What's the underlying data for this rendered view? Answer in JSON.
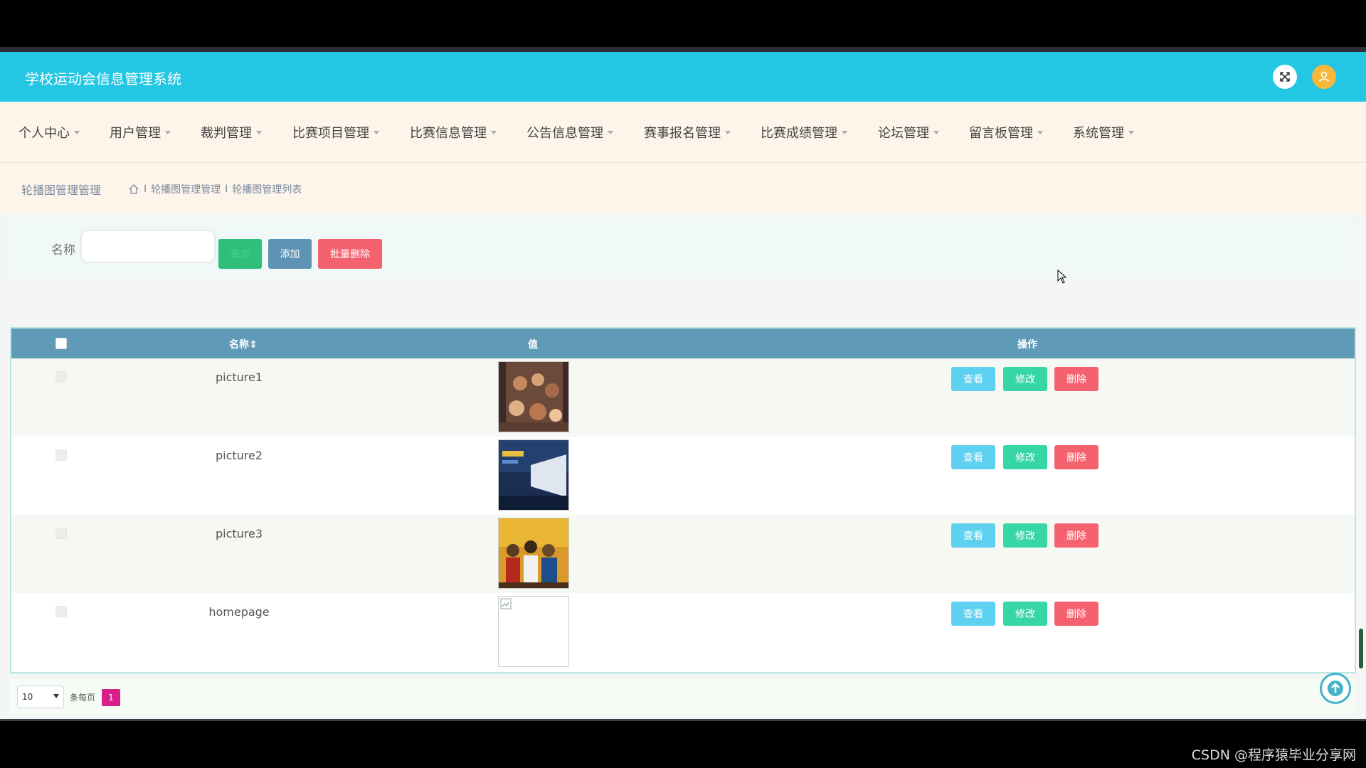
{
  "app": {
    "title": "学校运动会信息管理系统"
  },
  "header": {
    "expand_icon": "fullscreen-icon",
    "user_icon": "user-avatar-icon"
  },
  "nav": {
    "items": [
      {
        "label": "个人中心"
      },
      {
        "label": "用户管理"
      },
      {
        "label": "裁判管理"
      },
      {
        "label": "比赛项目管理"
      },
      {
        "label": "比赛信息管理"
      },
      {
        "label": "公告信息管理"
      },
      {
        "label": "赛事报名管理"
      },
      {
        "label": "比赛成绩管理"
      },
      {
        "label": "论坛管理"
      },
      {
        "label": "留言板管理"
      },
      {
        "label": "系统管理"
      }
    ]
  },
  "breadcrumb": {
    "page_title": "轮播图管理管理",
    "sep": "I",
    "level1": "轮播图管理管理",
    "level2": "轮播图管理列表"
  },
  "search": {
    "label": "名称",
    "value": "",
    "search_button": "查询",
    "add_button": "添加",
    "batch_delete_button": "批量删除"
  },
  "table": {
    "headers": {
      "name": "名称",
      "value": "值",
      "actions": "操作"
    },
    "rows": [
      {
        "name": "picture1",
        "image": "photo-crowd"
      },
      {
        "name": "picture2",
        "image": "photo-stage"
      },
      {
        "name": "picture3",
        "image": "photo-group"
      },
      {
        "name": "homepage",
        "image": "broken-image"
      }
    ],
    "action_labels": {
      "view": "查看",
      "edit": "修改",
      "delete": "删除"
    }
  },
  "pagination": {
    "page_size": "10",
    "per_page_label": "条每页",
    "current_page": "1"
  },
  "watermark": "CSDN @程序猿毕业分享网",
  "colors": {
    "header": "#23c6e3",
    "table_head": "#5f9ab7",
    "delete": "#f5626f",
    "edit": "#36d6a5",
    "view": "#5fd1f0",
    "add": "#5f93b5",
    "page_active": "#d81e88"
  }
}
